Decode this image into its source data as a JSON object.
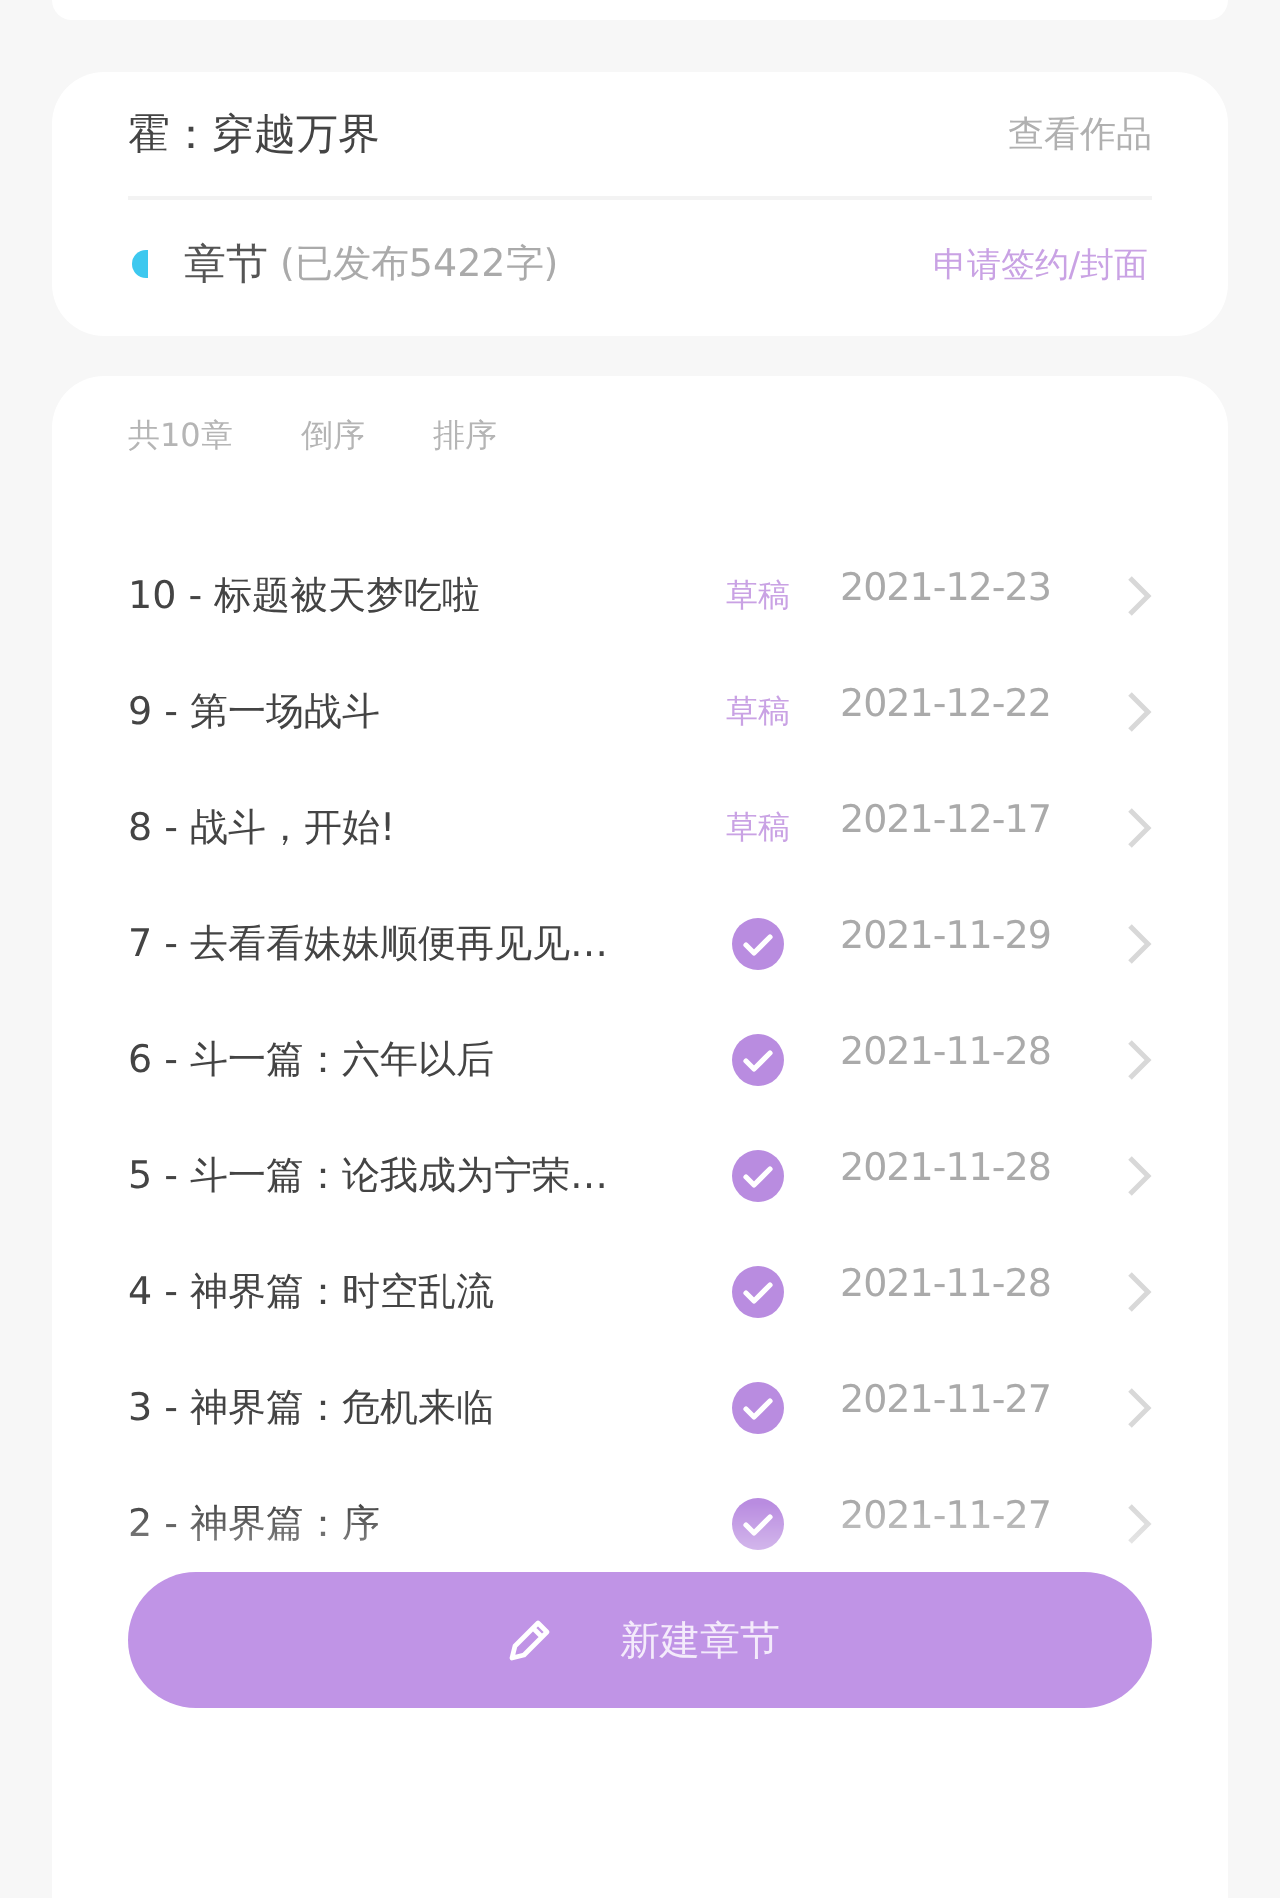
{
  "work": {
    "title": "霍：穿越万界",
    "view_link": "查看作品",
    "section_label": "章节",
    "section_count": "(已发布5422字)",
    "sign_link": "申请签约/封面"
  },
  "toolbar": [
    "共10章",
    "倒序",
    "排序"
  ],
  "chapters": [
    {
      "title": "10 - 标题被天梦吃啦",
      "kind": "draft",
      "status_label": "草稿",
      "date": "2021-12-23"
    },
    {
      "title": "9 - 第一场战斗",
      "kind": "draft",
      "status_label": "草稿",
      "date": "2021-12-22"
    },
    {
      "title": "8 - 战斗，开始!",
      "kind": "draft",
      "status_label": "草稿",
      "date": "2021-12-17"
    },
    {
      "title": "7 - 去看看妹妹顺便再见见…",
      "kind": "published",
      "date": "2021-11-29"
    },
    {
      "title": "6 - 斗一篇：六年以后",
      "kind": "published",
      "date": "2021-11-28"
    },
    {
      "title": "5 - 斗一篇：论我成为宁荣…",
      "kind": "published",
      "date": "2021-11-28"
    },
    {
      "title": "4 - 神界篇：时空乱流",
      "kind": "published",
      "date": "2021-11-28"
    },
    {
      "title": "3 - 神界篇：危机来临",
      "kind": "published",
      "date": "2021-11-27"
    },
    {
      "title": "2 - 神界篇：序",
      "kind": "published",
      "date": "2021-11-27"
    }
  ],
  "new_button": "新建章节"
}
